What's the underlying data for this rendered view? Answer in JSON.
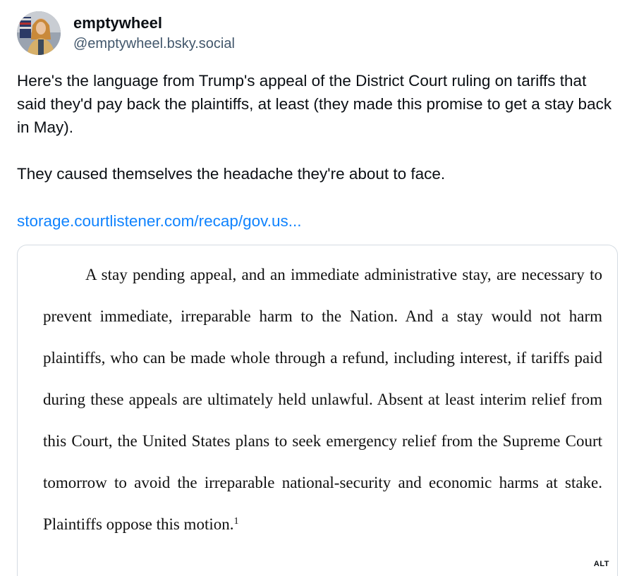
{
  "author": {
    "display_name": "emptywheel",
    "handle": "@emptywheel.bsky.social",
    "avatar": "avatar-image"
  },
  "post": {
    "paragraph_1": "Here's the language from Trump's appeal of the District Court ruling on tariffs that said they'd pay back the plaintiffs, at least (they made this promise to get a stay back in May).",
    "paragraph_2": "They caused themselves the headache they're about to face.",
    "link_text": "storage.courtlistener.com/recap/gov.us..."
  },
  "image": {
    "document_text": "A stay pending appeal, and an immediate administrative stay, are necessary to prevent immediate, irreparable harm to the Nation.  And a stay would not harm plaintiffs, who can be made whole through a refund, including interest, if tariffs paid during these appeals are ultimately held unlawful.  Absent at least interim relief from this Court, the United States plans to seek emergency relief from the Supreme Court tomorrow to avoid the irreparable national-security and economic harms at stake.  Plaintiffs oppose this motion.",
    "footnote_marker": "1",
    "alt_badge": "ALT"
  },
  "colors": {
    "text": "#0b0f14",
    "handle": "#42576c",
    "link": "#1083fe",
    "border": "#d4dbe2"
  }
}
